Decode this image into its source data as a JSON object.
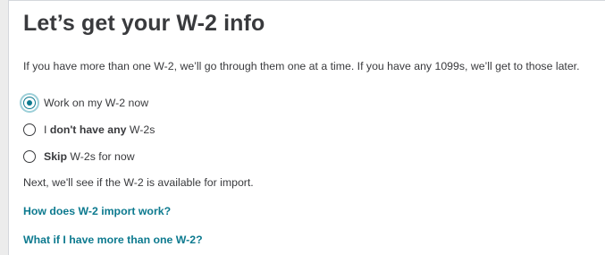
{
  "page": {
    "title": "Let’s get your W-2 info",
    "intro": "If you have more than one W-2, we’ll go through them one at a time. If you have any 1099s, we’ll get to those later."
  },
  "options": [
    {
      "bold": "",
      "text": "Work on my W-2 now",
      "selected": true
    },
    {
      "prefix": "I ",
      "bold": "don't have any",
      "text": " W-2s",
      "selected": false
    },
    {
      "bold": "Skip",
      "text": " W-2s for now",
      "selected": false
    }
  ],
  "next_note": "Next, we'll see if the W-2 is available for import.",
  "links": {
    "import_help": "How does W-2 import work?",
    "multiple_help": "What if I have more than one W-2?"
  },
  "colors": {
    "accent": "#0d7a8f",
    "text": "#393a3d"
  }
}
